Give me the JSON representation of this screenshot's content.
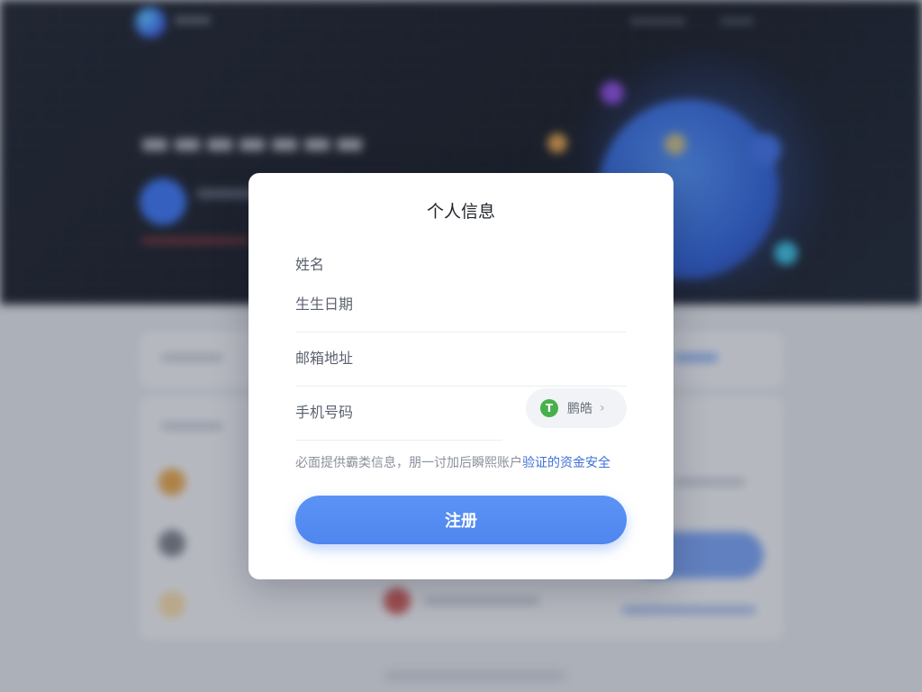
{
  "modal": {
    "title": "个人信息",
    "fields": {
      "name_label": "姓名",
      "birthdate_label": "生生日期",
      "email_label": "邮箱地址",
      "phone_label": "手机号码"
    },
    "verify": {
      "icon_glyph": "T",
      "label": "鹏皓",
      "chevron": "›"
    },
    "notice": {
      "text": "必面提供霸类信息，朋一讨加后瞬熙账户",
      "highlight": "验证的资金安全"
    },
    "register_label": "注册"
  },
  "colors": {
    "primary_button": "#4f86ef",
    "verify_icon": "#47b04b",
    "notice_highlight": "#3f6fd8"
  }
}
